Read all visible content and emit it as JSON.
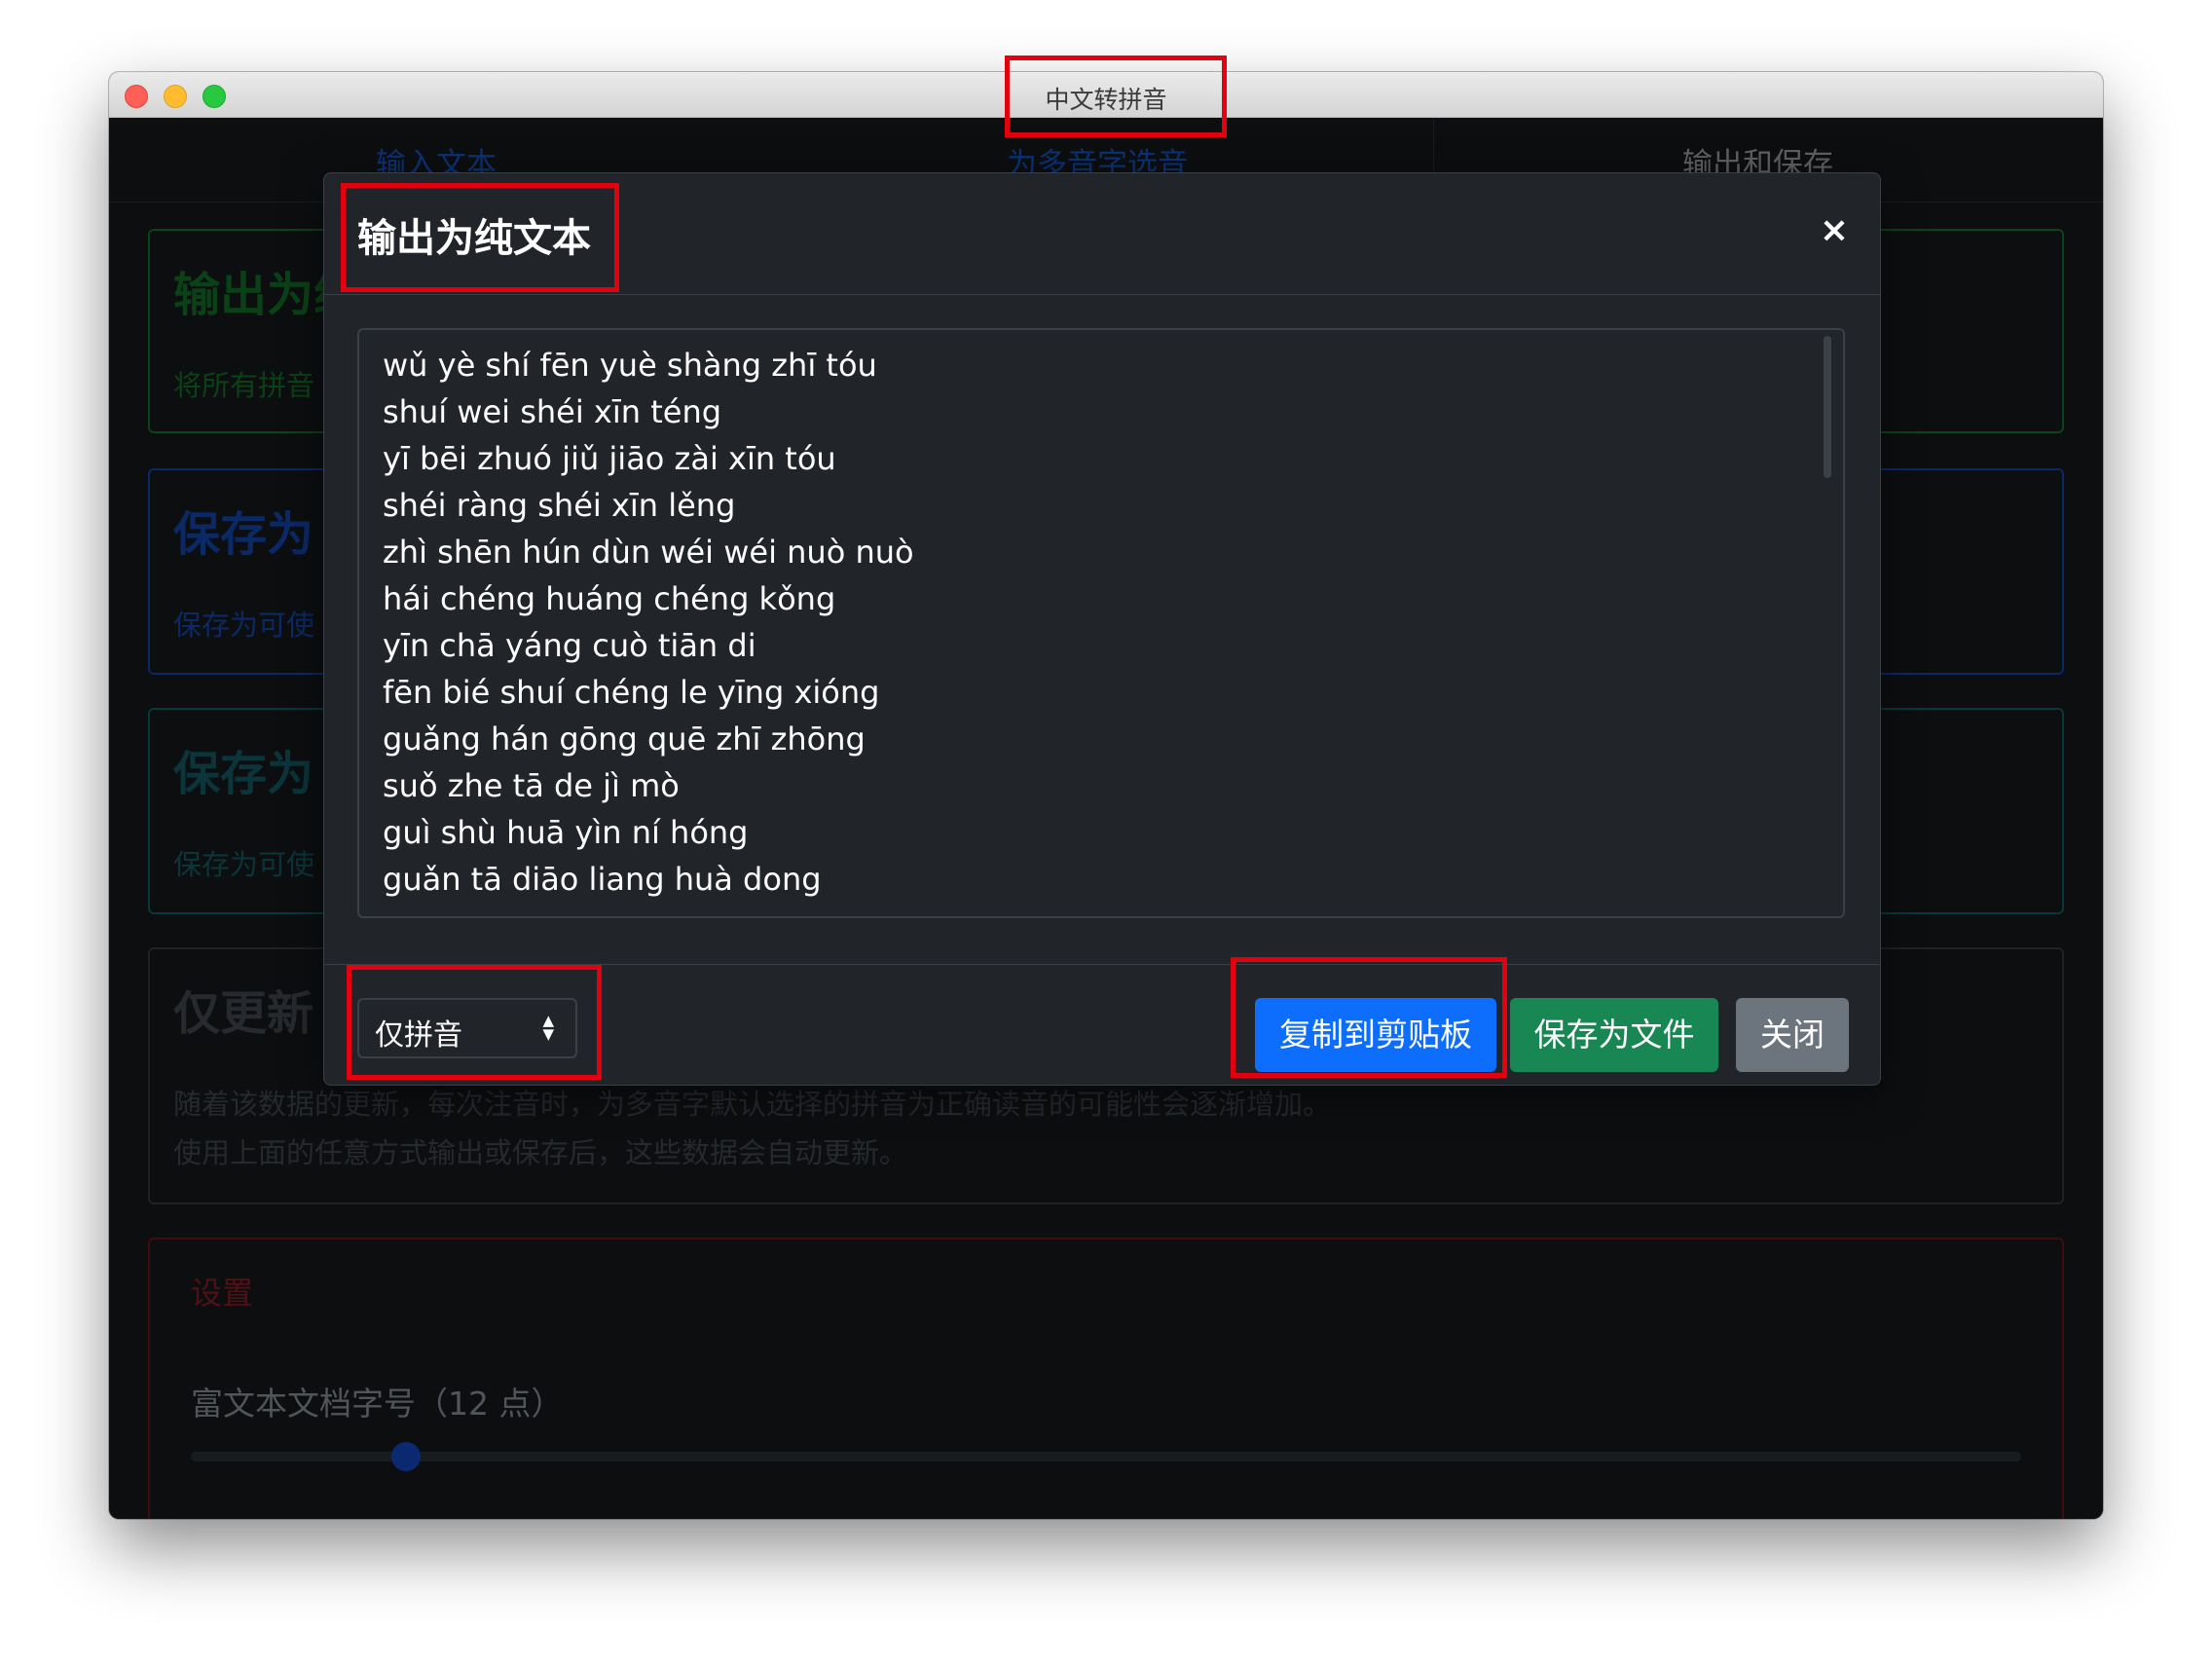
{
  "window": {
    "title": "中文转拼音"
  },
  "tabs": [
    {
      "label": "输入文本"
    },
    {
      "label": "为多音字选音"
    },
    {
      "label": "输出和保存"
    }
  ],
  "background": {
    "card1": {
      "title": "输出为纯",
      "subtitle": "将所有拼音"
    },
    "card2": {
      "title": "保存为",
      "subtitle": "保存为可使"
    },
    "card3": {
      "title": "保存为",
      "subtitle": "保存为可使"
    },
    "card4": {
      "title": "仅更新",
      "desc_line1": "随着该数据的更新，每次注音时，为多音字默认选择的拼音为正确读音的可能性会逐渐增加。",
      "desc_line2": "使用上面的任意方式输出或保存后，这些数据会自动更新。"
    },
    "settings": {
      "title": "设置",
      "font_size_label": "富文本文档字号（12 点）",
      "font_size_value": 12
    }
  },
  "modal": {
    "title": "输出为纯文本",
    "close_icon": "×",
    "lines": [
      "wǔ yè shí fēn yuè shàng zhī tóu",
      "shuí wei shéi xīn téng",
      "yī bēi zhuó jiǔ jiāo zài xīn tóu",
      "shéi ràng shéi xīn lěng",
      "zhì shēn hún dùn wéi wéi nuò nuò",
      "hái chéng huáng chéng kǒng",
      "yīn chā yáng cuò tiān di",
      "fēn bié shuí chéng le yīng xióng",
      "guǎng hán gōng quē zhī zhōng",
      "suǒ zhe tā de jì mò",
      "guì shù huā yìn ní hóng",
      "guǎn tā diāo liang huà dong"
    ],
    "select_value": "仅拼音",
    "buttons": {
      "copy": "复制到剪贴板",
      "save": "保存为文件",
      "close": "关闭"
    }
  },
  "colors": {
    "modal_bg": "#212529",
    "primary": "#0d6efd",
    "success": "#198754",
    "secondary": "#6c757d",
    "highlight": "#e3000f"
  }
}
